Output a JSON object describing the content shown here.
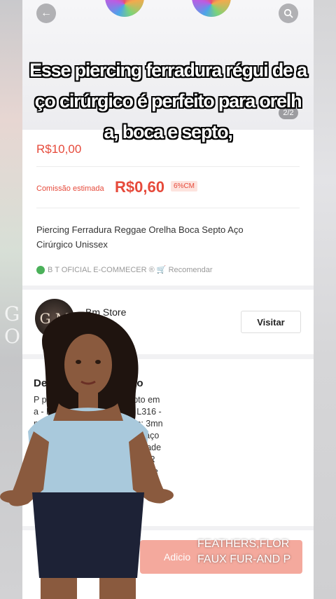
{
  "hero": {
    "image_counter": "2/2"
  },
  "product": {
    "price": "R$10,00",
    "commission_label": "Comissão estimada",
    "commission_value": "R$0,60",
    "commission_badge": "6%CM",
    "title": "Piercing Ferradura Reggae Orelha Boca Septo Aço Cirúrgico Unissex",
    "seller_line": "B T OFICIAL E-COMMECER ® 🛒 Recomendar"
  },
  "store": {
    "avatar_initials": "G M",
    "name": "Bm Store",
    "sub": "tos",
    "visit_label": "Visitar"
  },
  "description": {
    "title_left": "De",
    "title_right": "uto",
    "lines": "P                    para Orelha, Boca e Septo em\n                        a - Material: Aço Cirúrgico L316 -\n                       nm - Tamanho das bolinhas: 3mn\n                       ualidade, confeccionado em aço\n                       oporcionando maior durabilidade\n                     * Cuidados com as Peças POR\n                     ÇÃO : Para garantir a qualidade\n                      orme os abaixo alguns cuidados\n                        elhor conservação de sua\npe                     argadores e acessórios):"
  },
  "cta": {
    "add_label": "Adicio"
  },
  "caption": {
    "line1": "Esse piercing ferradura régui de a",
    "line2": "ço cirúrgico é perfeito para orelh",
    "line3": "a, boca e septo,"
  },
  "overlay_banner": {
    "line1": "FEATHERS,FLOR",
    "line2": "FAUX FUR-AND P"
  },
  "ghost_left": {
    "line1": "G",
    "line2": "O"
  },
  "icons": {
    "back": "back-arrow-icon",
    "search": "search-icon",
    "seller": "seller-badge-icon"
  },
  "colors": {
    "accent": "#e64a3b",
    "badge_bg": "#fde3de",
    "cta": "#f4a99d"
  }
}
